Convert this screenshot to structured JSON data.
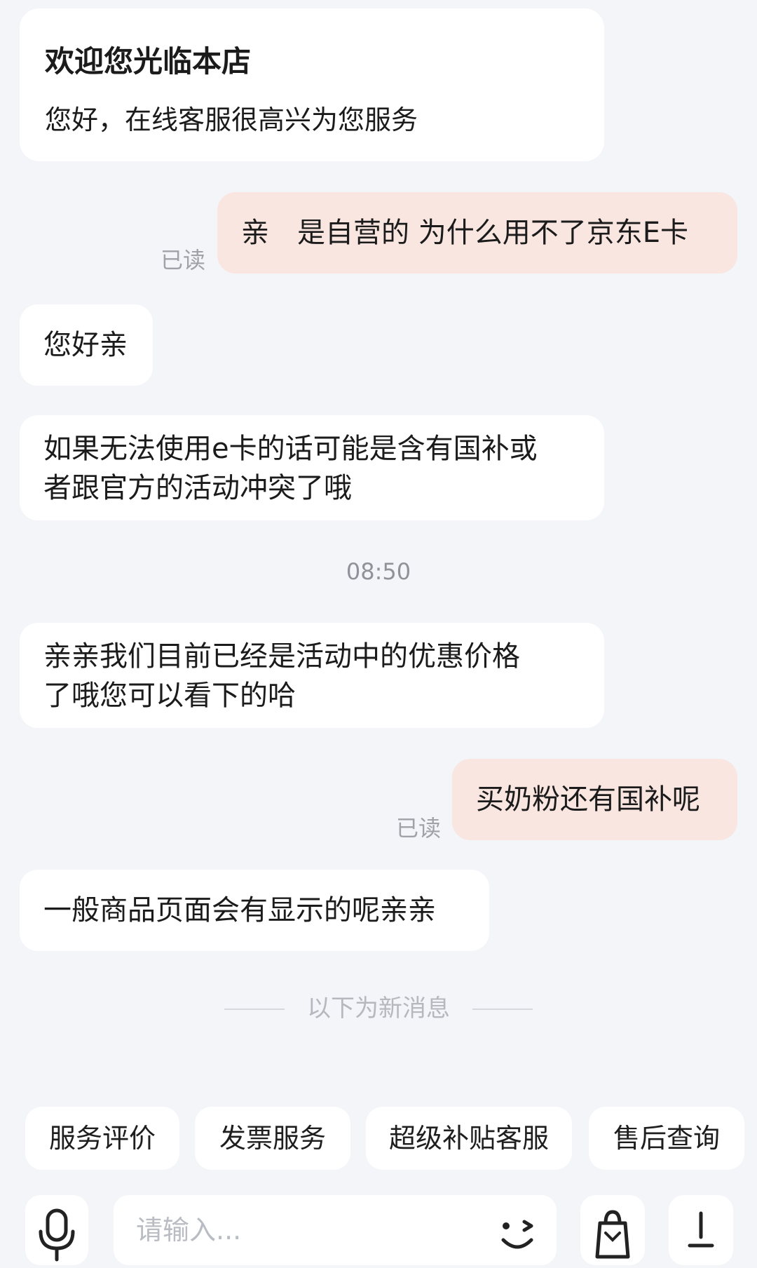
{
  "welcome": {
    "title": "欢迎您光临本店",
    "subtitle": "您好，在线客服很高兴为您服务"
  },
  "messages": [
    {
      "from": "user",
      "text": "亲　是自营的 为什么用不了京东E卡",
      "status": "已读"
    },
    {
      "from": "agent",
      "text": "您好亲"
    },
    {
      "from": "agent",
      "lines": [
        "如果无法使用e卡的话可能是含有国补或",
        "者跟官方的活动冲突了哦"
      ]
    },
    {
      "from": "agent",
      "lines": [
        "亲亲我们目前已经是活动中的优惠价格",
        "了哦您可以看下的哈"
      ]
    },
    {
      "from": "user",
      "text": "买奶粉还有国补呢",
      "status": "已读"
    },
    {
      "from": "agent",
      "text": "一般商品页面会有显示的呢亲亲"
    }
  ],
  "timestamp": "08:50",
  "divider_label": "以下为新消息",
  "quick_replies": [
    "服务评价",
    "发票服务",
    "超级补贴客服",
    "售后查询"
  ],
  "input": {
    "placeholder": "请输入..."
  },
  "icons": {
    "voice": "microphone-icon",
    "emoji": "emoji-wink-icon",
    "product": "shopping-bag-icon",
    "more": "more-icon"
  }
}
